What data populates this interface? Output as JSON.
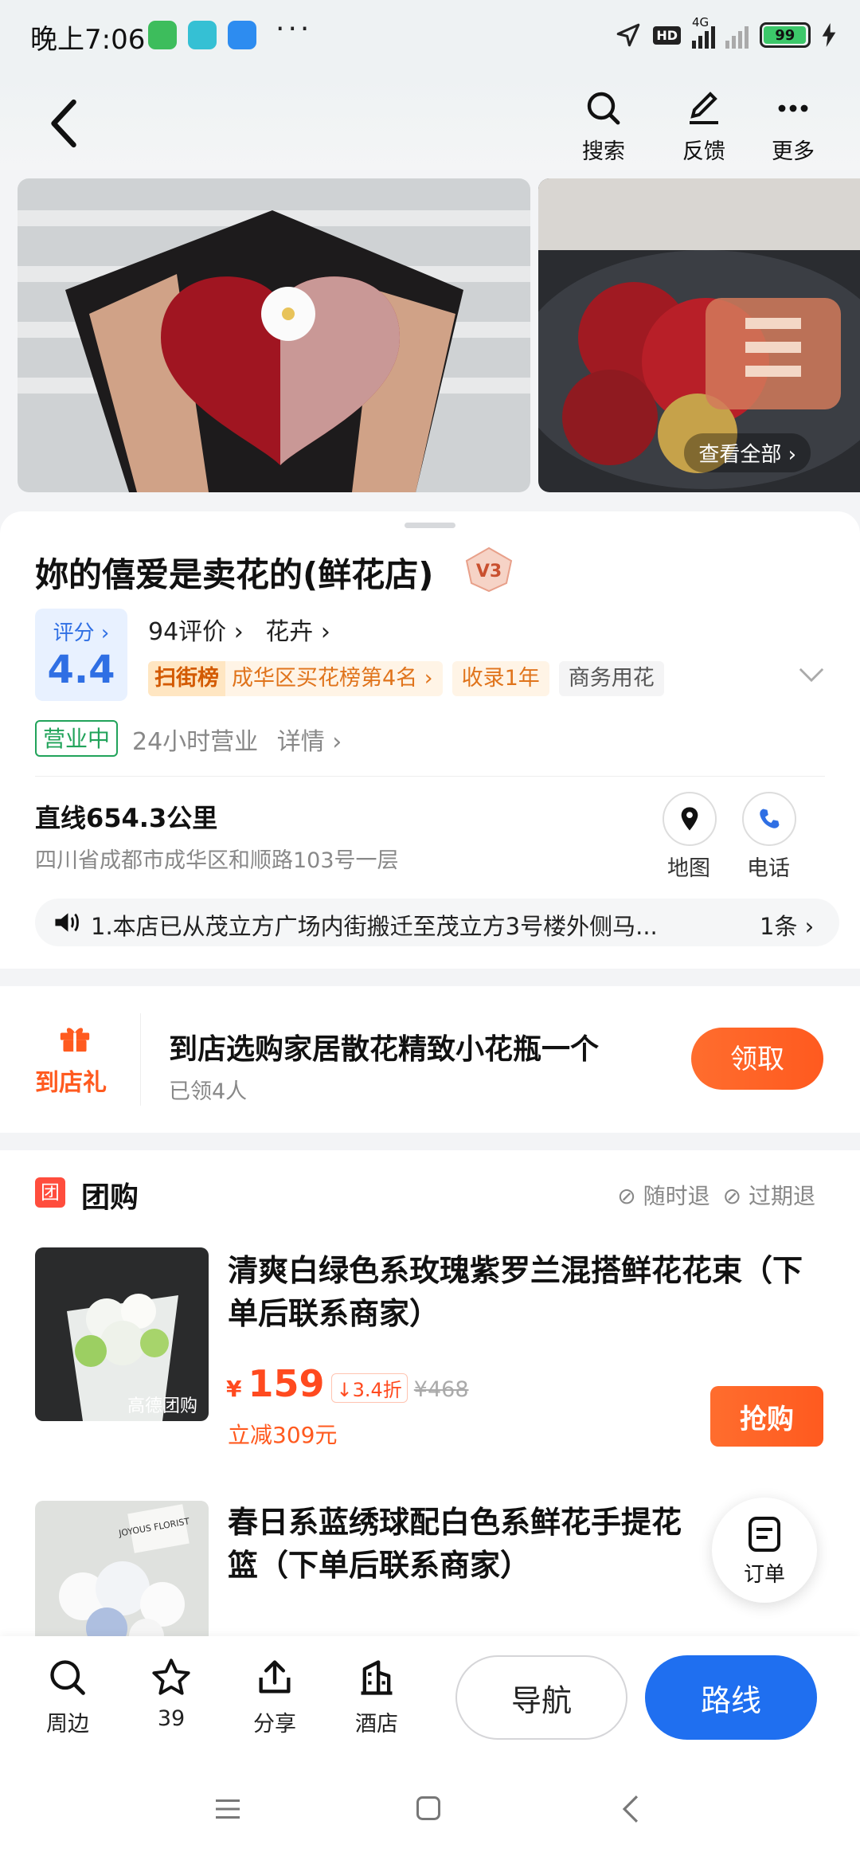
{
  "status_bar": {
    "time": "晚上7:06",
    "network": "4G",
    "hd": "HD",
    "battery": "99"
  },
  "top_bar": {
    "search": "搜索",
    "feedback": "反馈",
    "more": "更多"
  },
  "gallery": {
    "view_all": "查看全部"
  },
  "shop": {
    "name": "妳的僖爱是卖花的(鲜花店)",
    "level": "V3",
    "score_label": "评分",
    "score": "4.4",
    "reviews": "94评价",
    "category": "花卉",
    "rank_badge": "扫街榜",
    "rank_text": "成华区买花榜第4名",
    "included": "收录1年",
    "tag": "商务用花",
    "status": "营业中",
    "hours": "24小时营业",
    "details": "详情",
    "distance": "直线654.3公里",
    "address": "四川省成都市成华区和顺路103号一层",
    "map": "地图",
    "phone": "电话",
    "notice": "1.本店已从茂立方广场内街搬迁至茂立方3号楼外侧马...",
    "notice_count": "1条"
  },
  "gift": {
    "label": "到店礼",
    "title": "到店选购家居散花精致小花瓶一个",
    "sub": "已领4人",
    "button": "领取"
  },
  "group_buy": {
    "title": "团购",
    "tag_refund": "随时退",
    "tag_expire": "过期退",
    "items": [
      {
        "title": "清爽白绿色系玫瑰紫罗兰混搭鲜花花束（下单后联系商家）",
        "watermark": "高德团购",
        "currency": "¥",
        "price": "159",
        "discount": "3.4折",
        "original": "¥468",
        "save": "立减309元",
        "button": "抢购"
      },
      {
        "title": "春日系蓝绣球配白色系鲜花手提花篮（下单后联系商家）",
        "card_text": "JOYOUS FLORIST"
      }
    ]
  },
  "float_order": {
    "label": "订单"
  },
  "bottom_bar": {
    "nearby": "周边",
    "favorites": "39",
    "share": "分享",
    "hotel": "酒店",
    "navigate": "导航",
    "route": "路线"
  },
  "colors": {
    "accent_blue": "#1f6ff0",
    "accent_orange": "#ff5a1f",
    "open_green": "#21a35a"
  }
}
